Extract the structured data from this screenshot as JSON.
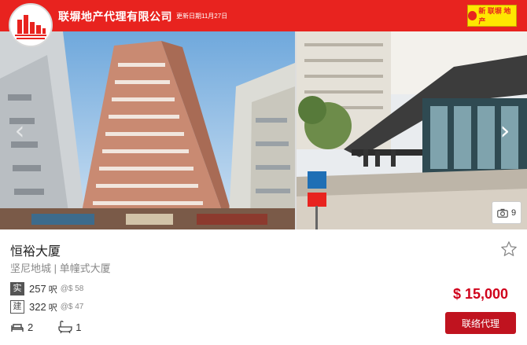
{
  "header": {
    "agency_name": "联塀地产代理有限公司",
    "update_date": "更新日期11月27日",
    "brand_badge": "新 联塀 地产",
    "color": "#e8231f"
  },
  "gallery": {
    "photo_count": "9",
    "icons": {
      "prev": "chevron-left-icon",
      "next": "chevron-right-icon",
      "camera": "camera-icon"
    }
  },
  "listing": {
    "title": "恒裕大厦",
    "subtitle": "坚尼地城 | 单幢式大厦",
    "net_area": {
      "tag": "实",
      "value": "257",
      "unit": "呎",
      "price_per_ft": "@$ 58"
    },
    "gross_area": {
      "tag": "建",
      "value": "322",
      "unit": "呎",
      "price_per_ft": "@$ 47"
    },
    "bedrooms": "2",
    "bathrooms": "1",
    "price": "$ 15,000",
    "contact_label": "联络代理",
    "price_color": "#d0021b"
  }
}
